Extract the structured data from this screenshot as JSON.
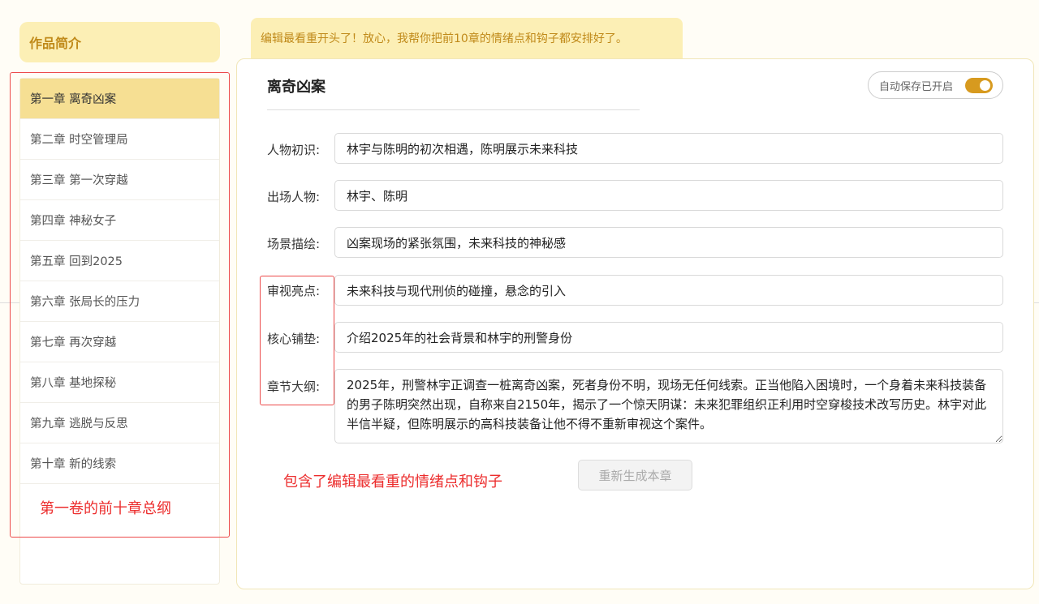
{
  "intro_button": "作品简介",
  "banner": "编辑最看重开头了！放心，我帮你把前10章的情绪点和钩子都安排好了。",
  "chapters": [
    {
      "label": "第一章 离奇凶案",
      "active": true
    },
    {
      "label": "第二章 时空管理局"
    },
    {
      "label": "第三章 第一次穿越"
    },
    {
      "label": "第四章 神秘女子"
    },
    {
      "label": "第五章 回到2025"
    },
    {
      "label": "第六章 张局长的压力"
    },
    {
      "label": "第七章 再次穿越"
    },
    {
      "label": "第八章 基地探秘"
    },
    {
      "label": "第九章 逃脱与反思"
    },
    {
      "label": "第十章 新的线索"
    }
  ],
  "panel": {
    "title": "离奇凶案",
    "autosave_label": "自动保存已开启",
    "autosave_on": true,
    "fields": [
      {
        "label": "人物初识:",
        "value": "林宇与陈明的初次相遇，陈明展示未来科技"
      },
      {
        "label": "出场人物:",
        "value": "林宇、陈明"
      },
      {
        "label": "场景描绘:",
        "value": "凶案现场的紧张氛围，未来科技的神秘感"
      },
      {
        "label": "审视亮点:",
        "value": "未来科技与现代刑侦的碰撞，悬念的引入"
      },
      {
        "label": "核心铺垫:",
        "value": "介绍2025年的社会背景和林宇的刑警身份"
      },
      {
        "label": "章节大纲:",
        "value": "2025年，刑警林宇正调查一桩离奇凶案，死者身份不明，现场无任何线索。正当他陷入困境时，一个身着未来科技装备的男子陈明突然出现，自称来自2150年，揭示了一个惊天阴谋：未来犯罪组织正利用时空穿梭技术改写历史。林宇对此半信半疑，但陈明展示的高科技装备让他不得不重新审视这个案件。"
      }
    ],
    "regenerate_button": "重新生成本章"
  },
  "annotations": {
    "sidebar_note": "第一卷的前十章总纲",
    "fields_note": "包含了编辑最看重的情绪点和钩子"
  },
  "colors": {
    "accent": "#d79a1f",
    "highlight": "#fcefb5",
    "active_chapter": "#f6df93",
    "annotation_red": "#ec2d2d"
  }
}
